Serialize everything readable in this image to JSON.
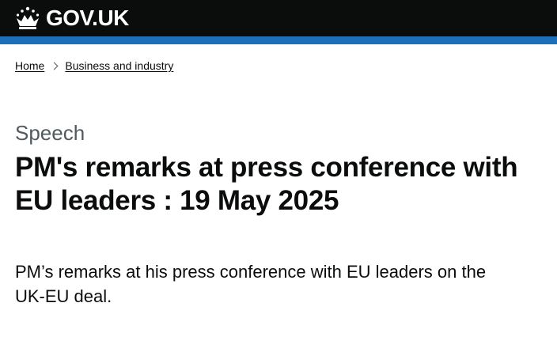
{
  "header": {
    "logo_text": "GOV.UK",
    "logo_icon": "crown-icon",
    "brand_color": "#1d70b8",
    "background_color": "#0b0c0c"
  },
  "breadcrumbs": [
    {
      "label": "Home"
    },
    {
      "label": "Business and industry"
    }
  ],
  "breadcrumb_separator_icon": "chevron-right-icon",
  "main": {
    "caption": "Speech",
    "title": "PM's remarks at press conference with EU leaders : 19 May 2025",
    "lead": "PM’s remarks at his press conference with EU leaders on the UK-EU deal."
  }
}
